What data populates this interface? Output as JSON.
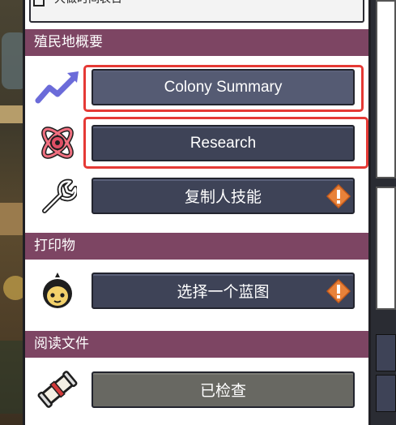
{
  "top_item": {
    "label": "大做时间表日"
  },
  "sections": {
    "colony": {
      "title": "殖民地概要"
    },
    "print": {
      "title": "打印物"
    },
    "docs": {
      "title": "阅读文件"
    }
  },
  "buttons": {
    "colony_summary": "Colony Summary",
    "research": "Research",
    "duplicant_skills": "复制人技能",
    "select_blueprint": "选择一个蓝图",
    "reviewed": "已检查"
  },
  "icons": {
    "colony_summary": "trend-up-icon",
    "research": "atom-icon",
    "skills": "wrench-icon",
    "printables": "duplicant-face-icon",
    "docs": "scroll-icon",
    "warning": "warning-diamond-icon"
  },
  "colors": {
    "section_header": "#7d4563",
    "button": "#3e4357",
    "button_gray": "#686862",
    "highlight": "#e53935",
    "warning": "#e8823a"
  }
}
